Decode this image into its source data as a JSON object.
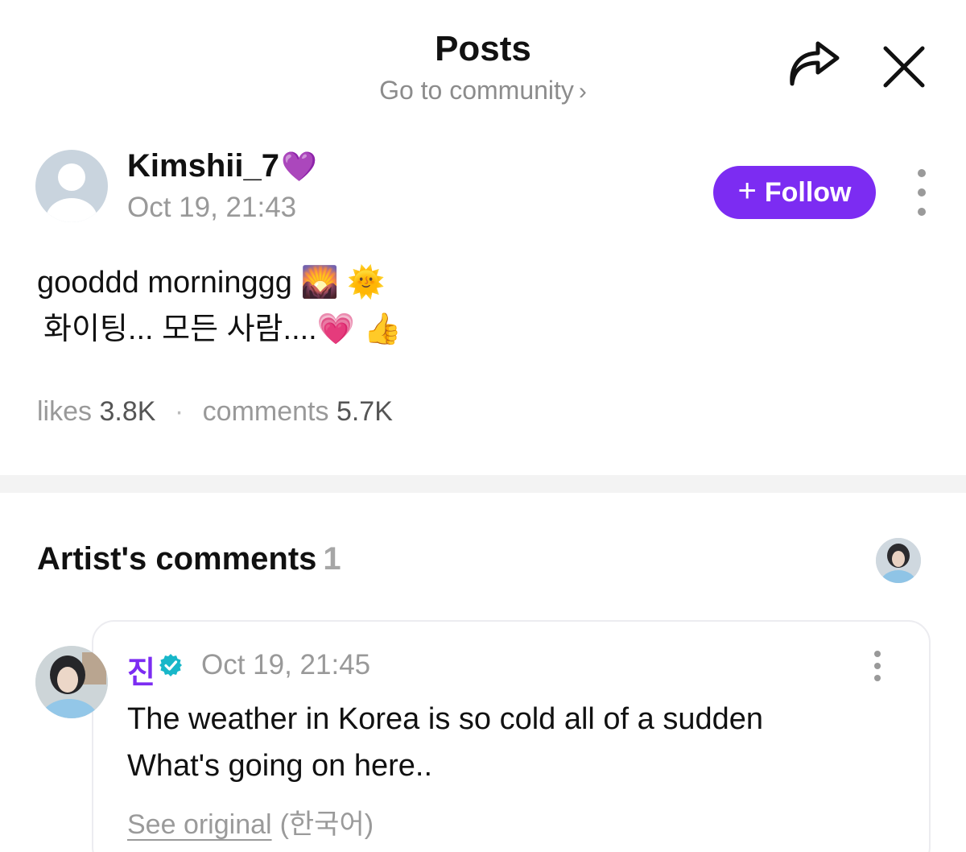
{
  "header": {
    "title": "Posts",
    "community_link": "Go to community",
    "community_chevron": "›",
    "share_icon": "share-arrow-icon",
    "close_icon": "close-icon"
  },
  "post": {
    "author": "Kimshii_7",
    "author_emoji": "💜",
    "timestamp": "Oct 19, 21:43",
    "follow_label": "Follow",
    "follow_plus": "+",
    "body_line1": "gooddd morninggg 🌄 🌞",
    "body_line2": "화이팅... 모든 사람....💗 👍",
    "likes_label": "likes",
    "likes_count": "3.8K",
    "separator": "·",
    "comments_label": "comments",
    "comments_count": "5.7K"
  },
  "artist_comments": {
    "title": "Artist's comments",
    "count": "1",
    "comment": {
      "author": "진",
      "timestamp": "Oct 19, 21:45",
      "text_line1": "The weather in Korea is so cold all of a sudden",
      "text_line2": "What's going on here..",
      "see_original": "See original",
      "language": "(한국어)"
    }
  },
  "colors": {
    "accent": "#7c2cf2",
    "muted": "#999999",
    "verified": "#18b7c9"
  }
}
